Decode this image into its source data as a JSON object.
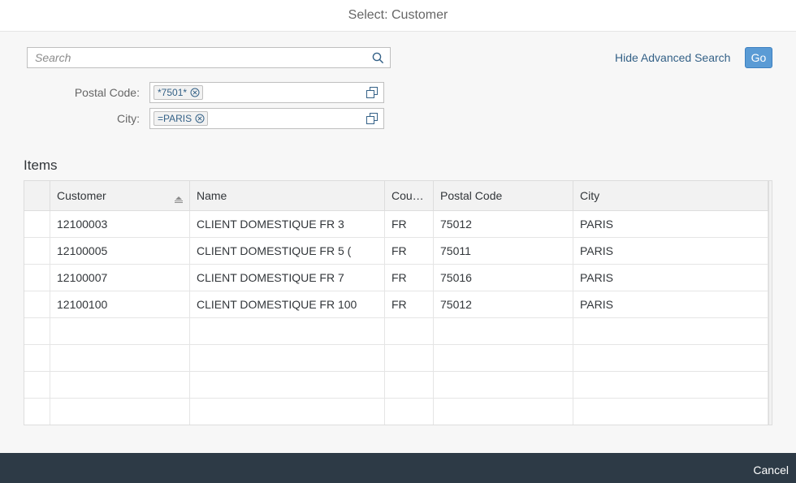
{
  "dialog": {
    "title": "Select: Customer"
  },
  "search": {
    "placeholder": "Search",
    "value": ""
  },
  "toolbar": {
    "hide_advanced_label": "Hide Advanced Search",
    "go_label": "Go"
  },
  "filters": [
    {
      "label": "Postal Code:",
      "token": "*7501*"
    },
    {
      "label": "City:",
      "token": "=PARIS"
    }
  ],
  "items": {
    "title": "Items",
    "columns": [
      "Customer",
      "Name",
      "Cou…",
      "Postal Code",
      "City"
    ],
    "rows": [
      [
        "12100003",
        "CLIENT DOMESTIQUE FR 3",
        "FR",
        "75012",
        "PARIS"
      ],
      [
        "12100005",
        "CLIENT DOMESTIQUE FR 5 (",
        "FR",
        "75011",
        "PARIS"
      ],
      [
        "12100007",
        "CLIENT DOMESTIQUE FR 7",
        "FR",
        "75016",
        "PARIS"
      ],
      [
        "12100100",
        "CLIENT DOMESTIQUE FR 100",
        "FR",
        "75012",
        "PARIS"
      ]
    ],
    "sorted_column": "Customer",
    "empty_rows": 4
  },
  "footer": {
    "cancel_label": "Cancel"
  },
  "colors": {
    "accent": "#5a9bd5",
    "link": "#346187",
    "footer_bg": "#2d3a46"
  },
  "icons": {
    "search": "search-icon",
    "value_help": "value-help-icon",
    "remove": "remove-token-icon",
    "sort": "sort-ascending-icon"
  }
}
